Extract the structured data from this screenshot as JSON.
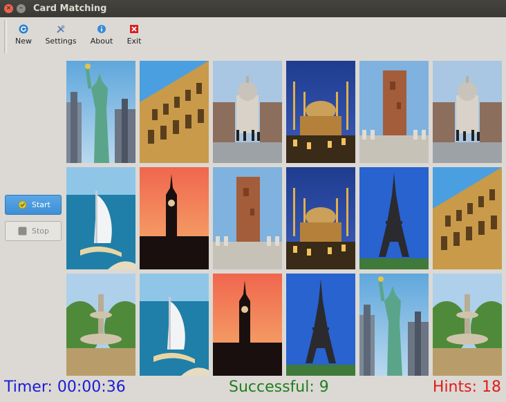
{
  "window": {
    "title": "Card Matching"
  },
  "toolbar": {
    "new_label": "New",
    "settings_label": "Settings",
    "about_label": "About",
    "exit_label": "Exit"
  },
  "side": {
    "start_label": "Start",
    "stop_label": "Stop"
  },
  "status": {
    "timer": "Timer: 00:00:36",
    "successful": "Successful: 9",
    "hints": "Hints: 18"
  },
  "grid": {
    "rows": [
      [
        "statue-of-liberty",
        "colosseum",
        "st-pauls-cathedral",
        "blue-mosque",
        "hassan-tower",
        "st-pauls-cathedral"
      ],
      [
        "burj-al-arab",
        "big-ben",
        "hassan-tower",
        "blue-mosque",
        "eiffel-tower",
        "colosseum"
      ],
      [
        "fountain",
        "burj-al-arab",
        "big-ben",
        "eiffel-tower",
        "statue-of-liberty",
        "fountain"
      ]
    ]
  },
  "colors": {
    "timer": "#1b1bd6",
    "successful": "#1f7d1f",
    "hints": "#e11b1b",
    "start_button": "#4a9be0"
  }
}
